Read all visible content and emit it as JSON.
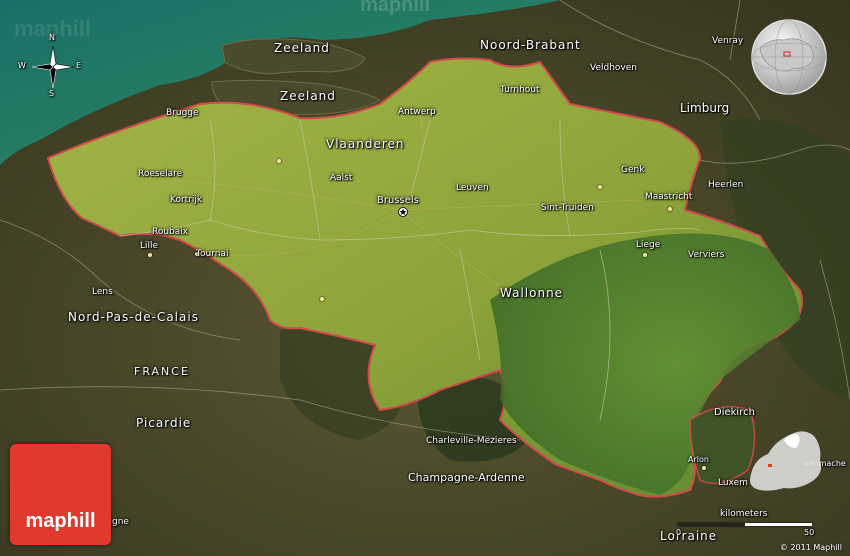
{
  "map": {
    "colors": {
      "sea": "#1d6e62",
      "outside": "#4a4628",
      "belgium": "#8fa83a",
      "ardennes": "#4f7f2c",
      "border": "#d24a4a"
    },
    "regions": [
      {
        "id": "zeeland-1",
        "text": "Zeeland"
      },
      {
        "id": "zeeland-2",
        "text": "Zeeland"
      },
      {
        "id": "noord-brabant",
        "text": "Noord-Brabant"
      },
      {
        "id": "vlaanderen",
        "text": "Vlaanderen"
      },
      {
        "id": "wallonne",
        "text": "Wallonne"
      },
      {
        "id": "limburg",
        "text": "Limburg"
      },
      {
        "id": "nord-pas-de-calais",
        "text": "Nord-Pas-de-Calais"
      },
      {
        "id": "picardie",
        "text": "Picardie"
      },
      {
        "id": "champagne-ardenne",
        "text": "Champagne-Ardenne"
      },
      {
        "id": "lorraine",
        "text": "Lorraine"
      },
      {
        "id": "france",
        "text": "FRANCE"
      }
    ],
    "cities": [
      {
        "id": "venray",
        "text": "Venray"
      },
      {
        "id": "veldhoven",
        "text": "Veldhoven"
      },
      {
        "id": "turnhout",
        "text": "Turnhout"
      },
      {
        "id": "antwerp",
        "text": "Antwerp"
      },
      {
        "id": "brugge",
        "text": "Brugge"
      },
      {
        "id": "roeselare",
        "text": "Roeselare"
      },
      {
        "id": "kortrijk",
        "text": "Kortrijk"
      },
      {
        "id": "aalst",
        "text": "Aalst"
      },
      {
        "id": "brussels",
        "text": "Brussels"
      },
      {
        "id": "leuven",
        "text": "Leuven"
      },
      {
        "id": "genk",
        "text": "Genk"
      },
      {
        "id": "maastricht",
        "text": "Maastricht"
      },
      {
        "id": "heerlen",
        "text": "Heerlen"
      },
      {
        "id": "sint-truiden",
        "text": "Sint-Truiden"
      },
      {
        "id": "roubaix",
        "text": "Roubaix"
      },
      {
        "id": "lille",
        "text": "Lille"
      },
      {
        "id": "tournai",
        "text": "Tournai"
      },
      {
        "id": "liege",
        "text": "Liege"
      },
      {
        "id": "verviers",
        "text": "Verviers"
      },
      {
        "id": "lens",
        "text": "Lens"
      },
      {
        "id": "charleville",
        "text": "Charleville-Mezieres"
      },
      {
        "id": "diekirch",
        "text": "Diekirch"
      },
      {
        "id": "arlon",
        "text": "Arlon"
      },
      {
        "id": "luxem",
        "text": "Luxem"
      },
      {
        "id": "venmache",
        "text": "venmache"
      },
      {
        "id": "gne",
        "text": "gne"
      }
    ],
    "compass": {
      "n": "N",
      "e": "E",
      "s": "S",
      "w": "W"
    },
    "scale": {
      "unit": "kilometers",
      "zero": "0",
      "max": "50"
    },
    "logo": "maphill",
    "watermark": "maphill",
    "copyright": "© 2011 Maphill"
  }
}
